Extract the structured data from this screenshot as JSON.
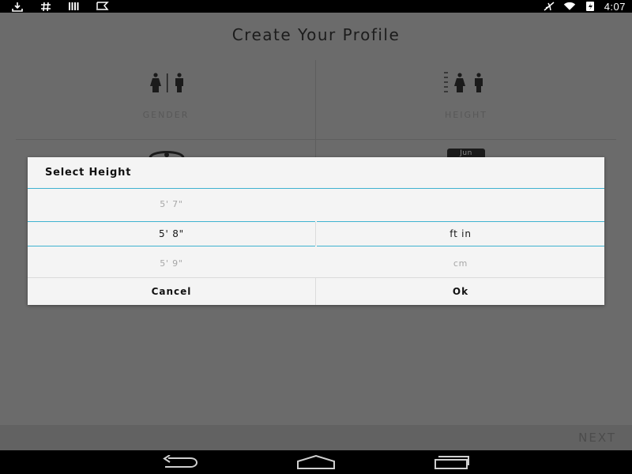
{
  "status_bar": {
    "left_icons": [
      "download-icon",
      "hash-icon",
      "barcode-icon",
      "flag-icon"
    ],
    "right_icons": [
      "airplane-mode-icon",
      "wifi-icon",
      "battery-charging-icon"
    ],
    "time": "4:07"
  },
  "page": {
    "title": "Create Your Profile",
    "tiles": [
      {
        "label": "GENDER",
        "icon": "gender-icon"
      },
      {
        "label": "HEIGHT",
        "icon": "height-icon"
      },
      {
        "label": "",
        "icon": "weight-icon"
      },
      {
        "label": "",
        "icon": "calendar-icon",
        "icon_text": "Jun"
      }
    ],
    "next_label": "NEXT"
  },
  "dialog": {
    "title": "Select Height",
    "height_picker": {
      "above": "5' 7\"",
      "selected": "5' 8\"",
      "below": "5' 9\""
    },
    "unit_picker": {
      "above": "",
      "selected": "ft in",
      "below": "cm"
    },
    "cancel_label": "Cancel",
    "ok_label": "Ok",
    "accent_color": "#3fb2d0"
  },
  "nav_bar": {
    "buttons": [
      "back-icon",
      "home-icon",
      "recent-apps-icon"
    ]
  },
  "colors": {
    "overlay_background": "#6b6b6b",
    "dialog_background": "#f4f4f4",
    "status_bar": "#000000"
  }
}
